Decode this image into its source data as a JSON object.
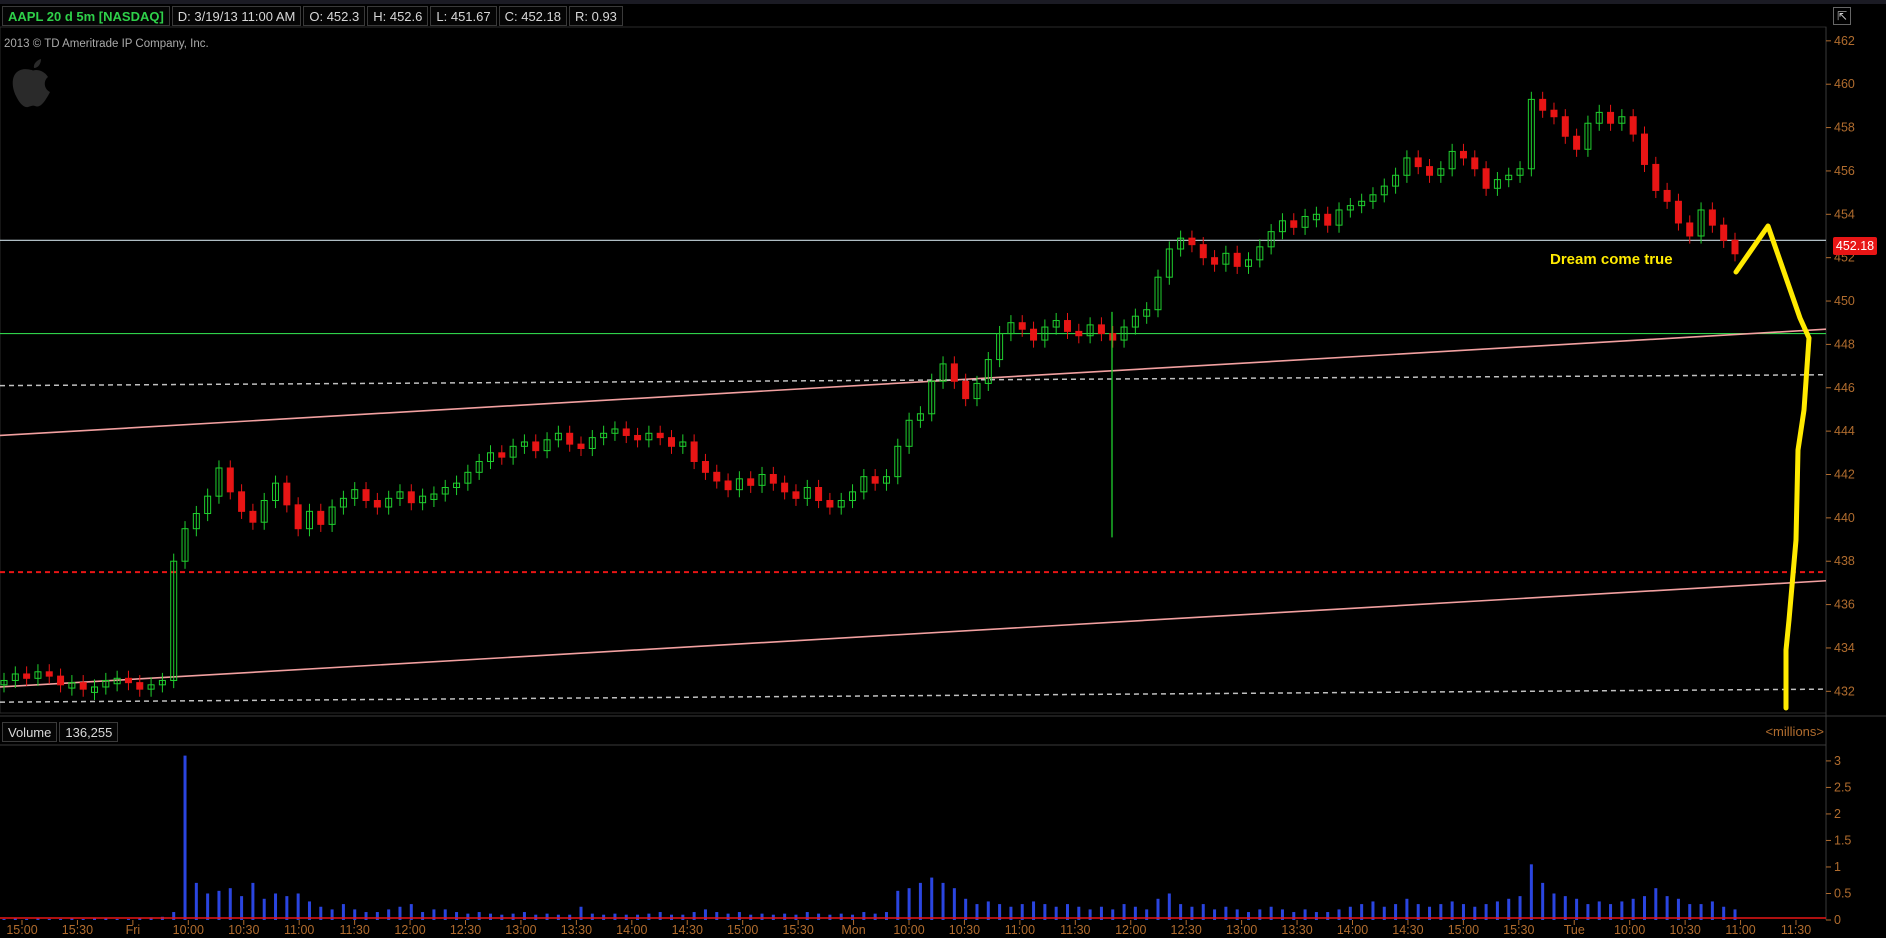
{
  "header": {
    "symbol": "AAPL 20 d 5m [NASDAQ]",
    "date": "D: 3/19/13 11:00 AM",
    "open": "O: 452.3",
    "high": "H: 452.6",
    "low": "L: 451.67",
    "close": "C: 452.18",
    "range": "R: 0.93"
  },
  "copyright": "2013 © TD Ameritrade IP Company, Inc.",
  "last_price_tag": "452.18",
  "annotation": "Dream come true",
  "volume_panel": {
    "label": "Volume",
    "value": "136,255",
    "units": "<millions>"
  },
  "colors": {
    "up": "#1fcf2e",
    "down": "#e81515",
    "axis": "#b06c2e",
    "annotation": "#ffea00",
    "channel": "#f2a0a0",
    "volume": "#2a45e0"
  },
  "chart_data": {
    "type": "candlestick",
    "price_axis": {
      "ylim": [
        431,
        462.5
      ],
      "ticks": [
        432,
        434,
        436,
        438,
        440,
        442,
        444,
        446,
        448,
        450,
        452,
        454,
        456,
        458,
        460,
        462
      ]
    },
    "volume_axis": {
      "ylim": [
        0,
        3.3
      ],
      "ticks": [
        "3",
        "2.5",
        "2",
        "1.5",
        "1",
        "0.5",
        "0"
      ]
    },
    "time_ticks": [
      "15:00",
      "15:30",
      "Fri",
      "10:00",
      "10:30",
      "11:00",
      "11:30",
      "12:00",
      "12:30",
      "13:00",
      "13:30",
      "14:00",
      "14:30",
      "15:00",
      "15:30",
      "Mon",
      "10:00",
      "10:30",
      "11:00",
      "11:30",
      "12:00",
      "12:30",
      "13:00",
      "13:30",
      "14:00",
      "14:30",
      "15:00",
      "15:30",
      "Tue",
      "10:00",
      "10:30",
      "11:00",
      "11:30"
    ],
    "last_price": 452.18,
    "horizontal_lines": [
      {
        "price": 452.8,
        "style": "solid",
        "color": "#c8d8e0"
      },
      {
        "price": 448.5,
        "style": "solid",
        "color": "#2fd14a"
      },
      {
        "price": 437.5,
        "style": "dashed",
        "color": "#e81515"
      }
    ],
    "trend_lines": [
      {
        "from": [
          0,
          443.8
        ],
        "to": [
          1.0,
          448.7
        ],
        "color": "#f2a0a0"
      },
      {
        "from": [
          0,
          432.2
        ],
        "to": [
          1.0,
          437.1
        ],
        "color": "#f2a0a0"
      },
      {
        "from": [
          0,
          446.1
        ],
        "to": [
          1.0,
          446.6
        ],
        "color": "#c0c0c0",
        "dashed": true
      },
      {
        "from": [
          0,
          431.5
        ],
        "to": [
          1.0,
          432.1
        ],
        "color": "#c0c0c0",
        "dashed": true
      }
    ],
    "candles_close": [
      432.5,
      432.8,
      432.6,
      432.9,
      432.7,
      432.3,
      432.4,
      432.1,
      432.2,
      432.5,
      432.6,
      432.4,
      432.1,
      432.3,
      432.5,
      438,
      439.5,
      440.2,
      441,
      442.3,
      441.2,
      440.3,
      439.8,
      440.8,
      441.6,
      440.6,
      439.5,
      440.3,
      439.7,
      440.5,
      440.9,
      441.3,
      440.8,
      440.5,
      440.9,
      441.2,
      440.7,
      441,
      441.1,
      441.4,
      441.6,
      442.1,
      442.6,
      443,
      442.8,
      443.3,
      443.5,
      443.1,
      443.6,
      443.9,
      443.4,
      443.2,
      443.7,
      443.9,
      444.1,
      443.8,
      443.6,
      443.9,
      443.7,
      443.3,
      443.5,
      442.6,
      442.1,
      441.7,
      441.3,
      441.8,
      441.5,
      442,
      441.6,
      441.2,
      440.9,
      441.4,
      440.8,
      440.5,
      440.8,
      441.2,
      441.9,
      441.6,
      441.9,
      443.3,
      444.5,
      444.8,
      446.3,
      447.1,
      446.3,
      445.5,
      446.2,
      447.3,
      448.5,
      449,
      448.7,
      448.2,
      448.8,
      449.1,
      448.6,
      448.4,
      448.9,
      448.5,
      448.2,
      448.8,
      449.3,
      449.6,
      451.1,
      452.4,
      452.9,
      452.6,
      452,
      451.7,
      452.2,
      451.6,
      451.9,
      452.5,
      453.2,
      453.7,
      453.4,
      453.9,
      454,
      453.5,
      454.2,
      454.4,
      454.6,
      454.9,
      455.3,
      455.8,
      456.6,
      456.2,
      455.8,
      456.1,
      456.9,
      456.6,
      456.1,
      455.2,
      455.6,
      455.8,
      456.1,
      459.3,
      458.8,
      458.5,
      457.6,
      457,
      458.2,
      458.7,
      458.2,
      458.5,
      457.7,
      456.3,
      455.1,
      454.6,
      453.6,
      453,
      454.2,
      453.5,
      452.8,
      452.18
    ],
    "candles_dir": [
      1,
      1,
      0,
      1,
      0,
      0,
      1,
      0,
      1,
      1,
      1,
      0,
      0,
      1,
      1,
      1,
      1,
      1,
      1,
      1,
      0,
      0,
      0,
      1,
      1,
      0,
      0,
      1,
      0,
      1,
      1,
      1,
      0,
      0,
      1,
      1,
      0,
      1,
      1,
      1,
      1,
      1,
      1,
      1,
      0,
      1,
      1,
      0,
      1,
      1,
      0,
      0,
      1,
      1,
      1,
      0,
      0,
      1,
      0,
      0,
      1,
      0,
      0,
      0,
      0,
      1,
      0,
      1,
      0,
      0,
      0,
      1,
      0,
      0,
      1,
      1,
      1,
      0,
      1,
      1,
      1,
      1,
      1,
      1,
      0,
      0,
      1,
      1,
      1,
      1,
      0,
      0,
      1,
      1,
      0,
      0,
      1,
      0,
      0,
      1,
      1,
      1,
      1,
      1,
      1,
      0,
      0,
      0,
      1,
      0,
      1,
      1,
      1,
      1,
      0,
      1,
      1,
      0,
      1,
      1,
      1,
      1,
      1,
      1,
      1,
      0,
      0,
      1,
      1,
      0,
      0,
      0,
      1,
      1,
      1,
      1,
      0,
      0,
      0,
      0,
      1,
      1,
      0,
      1,
      0,
      0,
      0,
      0,
      0,
      0,
      1,
      0,
      0,
      0
    ],
    "volume": [
      0.02,
      0.03,
      0.02,
      0.03,
      0.02,
      0.02,
      0.03,
      0.02,
      0.03,
      0.03,
      0.02,
      0.02,
      0.04,
      0.05,
      0.06,
      0.15,
      3.1,
      0.7,
      0.5,
      0.55,
      0.6,
      0.45,
      0.7,
      0.4,
      0.5,
      0.45,
      0.5,
      0.35,
      0.25,
      0.2,
      0.3,
      0.2,
      0.15,
      0.15,
      0.2,
      0.25,
      0.3,
      0.15,
      0.2,
      0.2,
      0.15,
      0.12,
      0.15,
      0.12,
      0.1,
      0.12,
      0.15,
      0.1,
      0.12,
      0.1,
      0.1,
      0.25,
      0.12,
      0.1,
      0.12,
      0.1,
      0.1,
      0.12,
      0.15,
      0.1,
      0.1,
      0.15,
      0.2,
      0.15,
      0.12,
      0.15,
      0.1,
      0.12,
      0.1,
      0.12,
      0.1,
      0.15,
      0.12,
      0.1,
      0.12,
      0.1,
      0.15,
      0.12,
      0.15,
      0.55,
      0.6,
      0.7,
      0.8,
      0.7,
      0.6,
      0.4,
      0.3,
      0.35,
      0.3,
      0.25,
      0.3,
      0.35,
      0.3,
      0.25,
      0.3,
      0.25,
      0.2,
      0.25,
      0.2,
      0.3,
      0.25,
      0.2,
      0.4,
      0.5,
      0.3,
      0.25,
      0.3,
      0.2,
      0.25,
      0.2,
      0.15,
      0.2,
      0.25,
      0.2,
      0.15,
      0.2,
      0.15,
      0.15,
      0.2,
      0.25,
      0.3,
      0.35,
      0.25,
      0.3,
      0.4,
      0.3,
      0.25,
      0.3,
      0.35,
      0.3,
      0.25,
      0.3,
      0.35,
      0.4,
      0.45,
      1.05,
      0.7,
      0.5,
      0.45,
      0.4,
      0.3,
      0.35,
      0.3,
      0.35,
      0.4,
      0.45,
      0.6,
      0.45,
      0.4,
      0.3,
      0.3,
      0.35,
      0.25,
      0.2
    ]
  }
}
